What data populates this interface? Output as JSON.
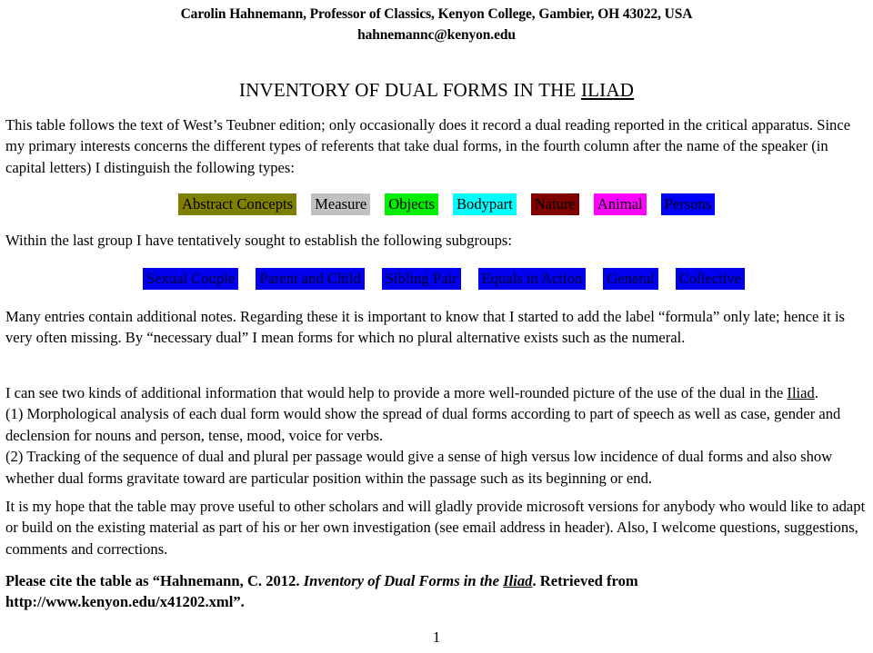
{
  "header": {
    "author_line": "Carolin Hahnemann, Professor of Classics, Kenyon College, Gambier, OH 43022, USA",
    "email_line": "hahnemannc@kenyon.edu"
  },
  "title": {
    "prefix": "INVENTORY OF DUAL FORMS IN THE ",
    "work": "ILIAD"
  },
  "intro": {
    "text": "This table follows the text of West’s Teubner edition; only occasionally does it record a dual reading reported in the critical apparatus. Since my primary interests concerns the different types of referents that take dual forms, in the fourth column after the name of the speaker (in capital letters) I distinguish the following types:"
  },
  "type_labels": [
    {
      "label": "Abstract Concepts",
      "bg": "#808000",
      "fg": "#000000"
    },
    {
      "label": "Measure",
      "bg": "#c0c0c0",
      "fg": "#000000"
    },
    {
      "label": "Objects",
      "bg": "#00ee00",
      "fg": "#000000"
    },
    {
      "label": "Bodypart",
      "bg": "#00ffff",
      "fg": "#000000"
    },
    {
      "label": "Nature",
      "bg": "#800000",
      "fg": "#000000"
    },
    {
      "label": "Animal",
      "bg": "#ff00ff",
      "fg": "#000000"
    },
    {
      "label": "Persons",
      "bg": "#0000ff",
      "fg": "#000000"
    }
  ],
  "subgroup_intro": {
    "text": "Within the last group I have tentatively sought to establish the following subgroups:"
  },
  "subgroup_labels": [
    {
      "label": "Sexual Couple",
      "bg": "#0000ee",
      "fg": "#000033"
    },
    {
      "label": "Parent and Child",
      "bg": "#0000ee",
      "fg": "#000033"
    },
    {
      "label": "Sibling Pair",
      "bg": "#0000ee",
      "fg": "#000033"
    },
    {
      "label": "Equals in Action",
      "bg": "#0000ee",
      "fg": "#000033"
    },
    {
      "label": "General",
      "bg": "#0000ee",
      "fg": "#000033"
    },
    {
      "label": "Collective",
      "bg": "#0000ee",
      "fg": "#000033"
    }
  ],
  "notes": {
    "text": "Many entries contain additional notes.  Regarding these it is important to know that I started to add the label “formula” only late; hence it is very often missing.  By “necessary dual” I mean forms for which no plural alternative exists such as the numeral."
  },
  "additional_info": {
    "lead_before_work": "I can see two kinds of additional information that would help to provide a more well-rounded picture of the use of the dual in the ",
    "lead_work": "Iliad",
    "lead_after_work": ".",
    "point_1": "(1)  Morphological analysis of each dual form would show the spread of dual forms according to part of speech as well as case, gender and declension for nouns and person, tense, mood, voice for verbs.",
    "point_2": "(2) Tracking of the sequence of dual and plural per passage would give a sense of high versus low incidence of dual forms and also show whether dual forms gravitate toward are particular position within the passage such as its beginning or end."
  },
  "hope": {
    "text": "It is my hope that the table may prove useful to other scholars and will gladly provide microsoft versions for anybody who would like to adapt or build on the existing material as part of his or her own investigation (see email address in header).  Also, I welcome questions, suggestions, comments and corrections."
  },
  "citation": {
    "before_title": "Please cite the table as “Hahnemann, C. 2012. ",
    "title_italic_before_work": "Inventory of Dual Forms in the ",
    "title_work": "Iliad",
    "after_work": ". Retrieved from http://www.kenyon.edu/x41202.xml”."
  },
  "footer": {
    "page_number": "1"
  }
}
